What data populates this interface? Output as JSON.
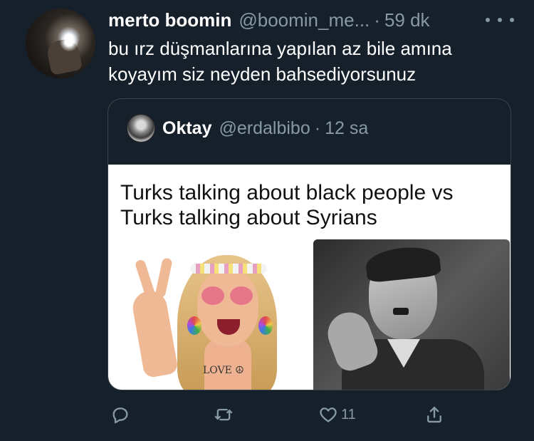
{
  "tweet": {
    "author_name": "merto boomin",
    "author_handle": "@boomin_me...",
    "separator": "·",
    "time": "59 dk",
    "text": "bu ırz düşmanlarına yapılan az bile amına koyayım siz neyden bahsediyorsunuz"
  },
  "quoted": {
    "author_name": "Oktay",
    "author_handle": "@erdalbibo",
    "separator": "·",
    "time": "12 sa",
    "meme_title": "Turks talking about black people vs Turks talking about Syrians",
    "tattoo_text": "LOVE ☮"
  },
  "actions": {
    "like_count": "11"
  },
  "icons": {
    "reply": "reply-icon",
    "retweet": "retweet-icon",
    "like": "heart-icon",
    "share": "share-icon",
    "more": "more-options-icon"
  },
  "colors": {
    "background": "#15202b",
    "secondary_text": "#8899a6",
    "border": "#38444d"
  }
}
